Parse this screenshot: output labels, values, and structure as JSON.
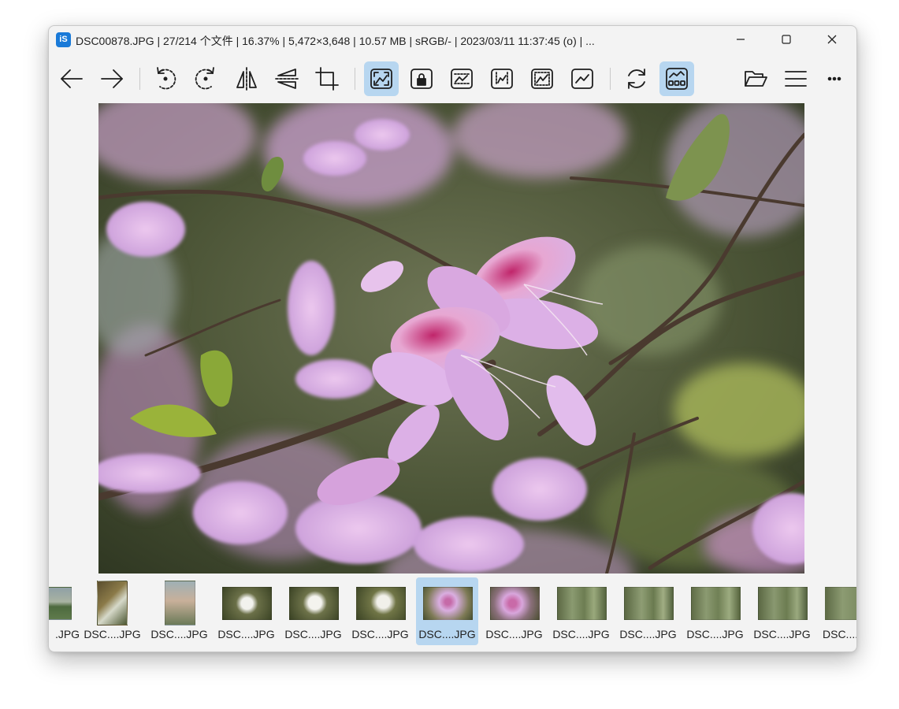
{
  "titlebar": {
    "app_icon_label": "iS",
    "title": "DSC00878.JPG   |   27/214 个文件   |   16.37%   |   5,472×3,648   |   10.57 MB   |   sRGB/-   |   2023/03/11 11:37:45 (o)   | ...",
    "controls": [
      "minimize-icon",
      "maximize-icon",
      "close-icon"
    ]
  },
  "toolbar": {
    "icons": [
      "arrow-left-icon",
      "arrow-right-icon",
      "rotate-left-icon",
      "rotate-right-icon",
      "flip-horizontal-icon",
      "flip-vertical-icon",
      "crop-icon",
      "auto-fit-icon",
      "lock-zoom-icon",
      "fit-width-icon",
      "fit-height-icon",
      "fill-window-icon",
      "original-size-icon",
      "refresh-icon",
      "thumbnail-bar-icon",
      "open-folder-icon",
      "main-menu-icon",
      "more-icon"
    ],
    "active": [
      "auto-fit-icon",
      "thumbnail-bar-icon"
    ]
  },
  "viewer": {
    "image_alt": "Pink orchid tree flowers on branches"
  },
  "thumbnails": [
    {
      "label": ".JPG",
      "kind": "river"
    },
    {
      "label": "DSC....JPG",
      "kind": "portrait-flower"
    },
    {
      "label": "DSC....JPG",
      "kind": "portrait-hand"
    },
    {
      "label": "DSC....JPG",
      "kind": "white-flower"
    },
    {
      "label": "DSC....JPG",
      "kind": "white-flower"
    },
    {
      "label": "DSC....JPG",
      "kind": "white-flower"
    },
    {
      "label": "DSC....JPG",
      "kind": "pink-flower",
      "selected": true
    },
    {
      "label": "DSC....JPG",
      "kind": "pink-flower"
    },
    {
      "label": "DSC....JPG",
      "kind": "forest"
    },
    {
      "label": "DSC....JPG",
      "kind": "forest"
    },
    {
      "label": "DSC....JPG",
      "kind": "forest"
    },
    {
      "label": "DSC....JPG",
      "kind": "forest"
    },
    {
      "label": "DSC....",
      "kind": "forest"
    }
  ],
  "colors": {
    "accent": "#b7d6f0",
    "window": "#f3f3f3",
    "app_icon": "#1a7ad8"
  }
}
